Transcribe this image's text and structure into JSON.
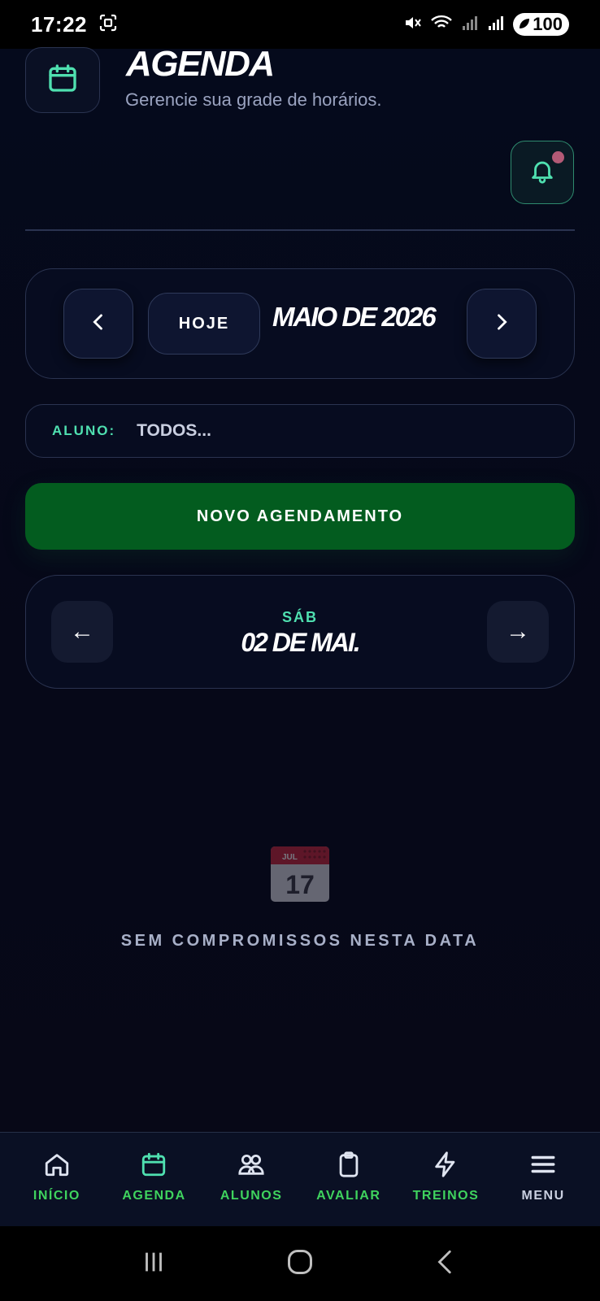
{
  "status_bar": {
    "time": "17:22",
    "battery": "100"
  },
  "header": {
    "title": "AGENDA",
    "subtitle": "Gerencie sua grade de horários."
  },
  "month_nav": {
    "today_label": "HOJE",
    "month_label": "MAIO DE 2026"
  },
  "filter": {
    "label": "ALUNO:",
    "value": "TODOS..."
  },
  "actions": {
    "new_appointment_label": "NOVO AGENDAMENTO"
  },
  "day_nav": {
    "weekday": "SÁB",
    "date": "02 DE MAI.",
    "prev_arrow": "←",
    "next_arrow": "→"
  },
  "empty_state": {
    "icon_month": "JUL",
    "icon_day": "17",
    "message": "SEM COMPROMISSOS NESTA DATA"
  },
  "bottom_nav": {
    "items": [
      {
        "label": "INÍCIO",
        "icon": "home-icon"
      },
      {
        "label": "AGENDA",
        "icon": "calendar-icon"
      },
      {
        "label": "ALUNOS",
        "icon": "users-icon"
      },
      {
        "label": "AVALIAR",
        "icon": "clipboard-icon"
      },
      {
        "label": "TREINOS",
        "icon": "bolt-icon"
      },
      {
        "label": "MENU",
        "icon": "menu-icon"
      }
    ]
  },
  "colors": {
    "background": "#050816",
    "accent_teal": "#4fe0b0",
    "primary_green": "#035c1f",
    "nav_green": "#3fd35e",
    "notification_dot": "#b35a76"
  }
}
